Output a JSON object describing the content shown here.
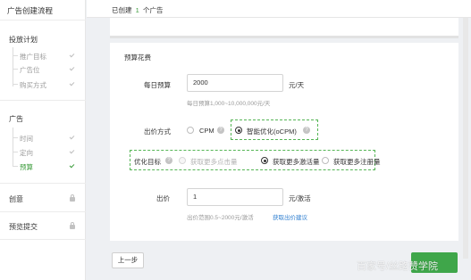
{
  "sidebar": {
    "title": "广告创建流程",
    "groups": [
      {
        "label": "投放计划",
        "items": [
          "推广目标",
          "广告位",
          "购买方式"
        ]
      },
      {
        "label": "广告",
        "items": [
          "时间",
          "定向",
          "预算"
        ]
      },
      {
        "label": "创意"
      },
      {
        "label": "预览提交"
      }
    ]
  },
  "topbar": {
    "created_prefix": "已创建",
    "created_count": "1",
    "created_suffix": "个广告"
  },
  "budget": {
    "section_title": "预算花费",
    "daily_label": "每日预算",
    "daily_value": "2000",
    "daily_unit": "元/天",
    "daily_hint": "每日预算1,000~10,000,000元/天",
    "bid_method_label": "出价方式",
    "bid_methods": [
      "CPM",
      "智能优化(oCPM)"
    ],
    "selected_bid_method": "智能优化(oCPM)",
    "goal_label": "优化目标",
    "goals": [
      "获取更多点击量",
      "获取更多激活量",
      "获取更多注册量"
    ],
    "selected_goal": "获取更多激活量",
    "bid_label": "出价",
    "bid_value": "1",
    "bid_unit": "元/激活",
    "bid_hint": "出价范围0.5~2000元/激活",
    "bid_suggest_link": "获取出价建议"
  },
  "footer": {
    "prev_label": "上一步"
  },
  "watermark": "百家号/丝路赞学院",
  "icons": {
    "completed": "check-icon",
    "locked": "lock-icon",
    "help": "question-circle-icon"
  },
  "colors": {
    "accent": "#3c9c3c",
    "primary_button": "#3fa64a",
    "link": "#2f7fd0",
    "dashed_highlight": "#55b555"
  }
}
